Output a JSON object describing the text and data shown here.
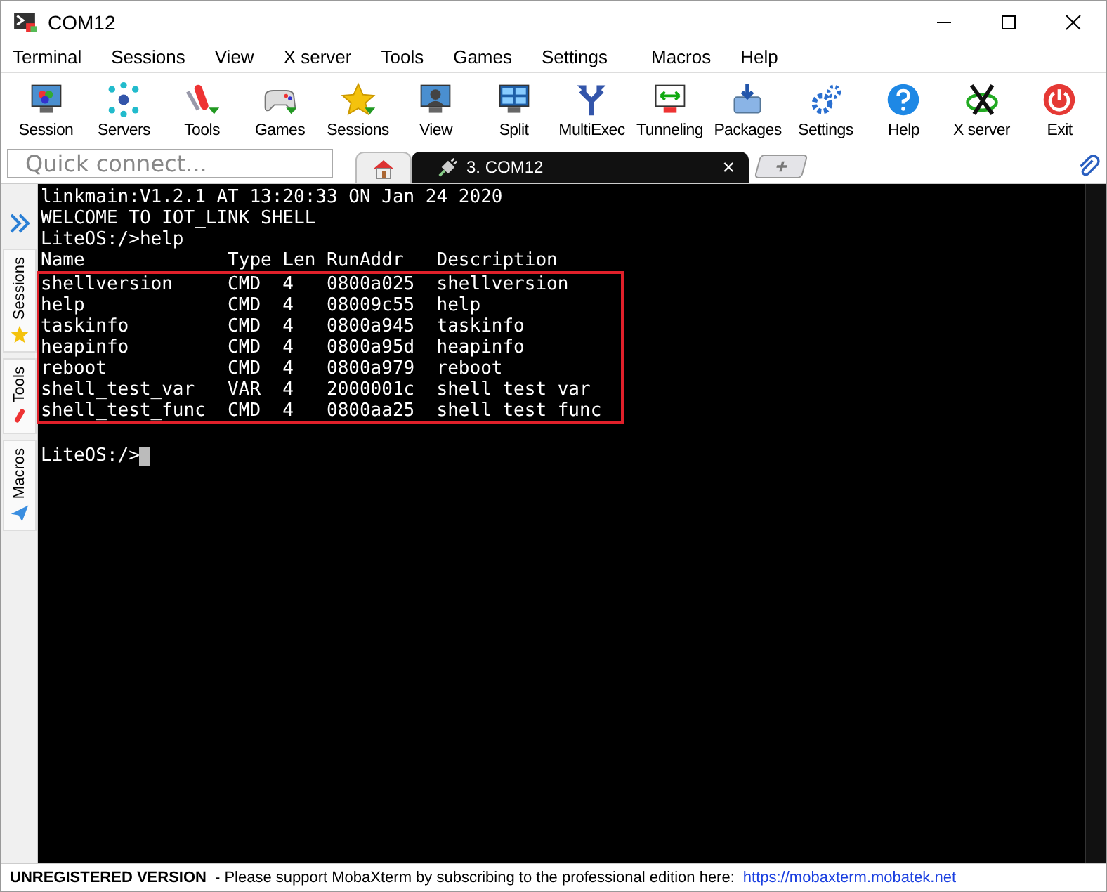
{
  "window": {
    "title": "COM12"
  },
  "menu": [
    "Terminal",
    "Sessions",
    "View",
    "X server",
    "Tools",
    "Games",
    "Settings",
    "Macros",
    "Help"
  ],
  "toolbar": [
    {
      "label": "Session"
    },
    {
      "label": "Servers"
    },
    {
      "label": "Tools"
    },
    {
      "label": "Games"
    },
    {
      "label": "Sessions"
    },
    {
      "label": "View"
    },
    {
      "label": "Split"
    },
    {
      "label": "MultiExec"
    },
    {
      "label": "Tunneling"
    },
    {
      "label": "Packages"
    },
    {
      "label": "Settings"
    },
    {
      "label": "Help"
    },
    {
      "label": "X server"
    },
    {
      "label": "Exit"
    }
  ],
  "quick_connect": {
    "placeholder": "Quick connect..."
  },
  "tabs": [
    {
      "kind": "home",
      "selected": false
    },
    {
      "kind": "session",
      "label": "3. COM12",
      "close": "×",
      "selected": true
    }
  ],
  "side_tabs": [
    {
      "label": "Sessions"
    },
    {
      "label": "Tools"
    },
    {
      "label": "Macros"
    }
  ],
  "terminal": {
    "lines": [
      "linkmain:V1.2.1 AT 13:20:33 ON Jan 24 2020",
      "WELCOME TO IOT_LINK SHELL",
      "LiteOS:/>help",
      "Name             Type Len RunAddr   Description"
    ],
    "highlighted_lines": [
      "shellversion     CMD  4   0800a025  shellversion",
      "help             CMD  4   08009c55  help",
      "taskinfo         CMD  4   0800a945  taskinfo",
      "heapinfo         CMD  4   0800a95d  heapinfo",
      "reboot           CMD  4   0800a979  reboot",
      "shell_test_var   VAR  4   2000001c  shell test var",
      "shell_test_func  CMD  4   0800aa25  shell test func"
    ],
    "prompt": "LiteOS:/>"
  },
  "status_bar": {
    "title": "UNREGISTERED VERSION",
    "message": "-  Please support MobaXterm by subscribing to the professional edition here:",
    "link": "https://mobaxterm.mobatek.net"
  }
}
